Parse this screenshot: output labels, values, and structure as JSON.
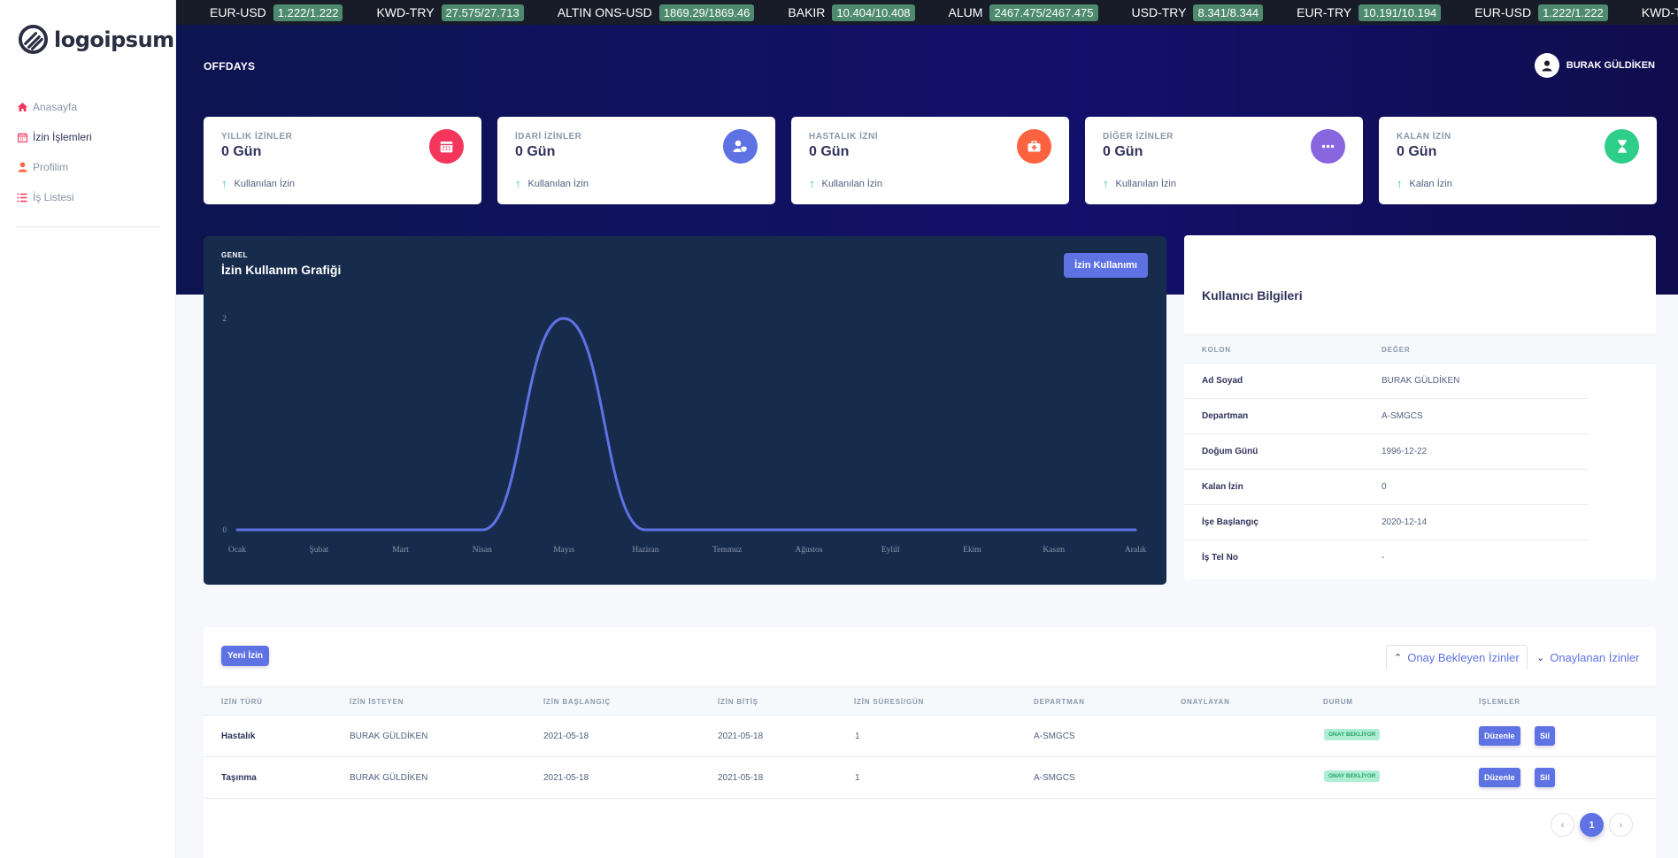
{
  "brand": {
    "name": "logoipsum"
  },
  "sidebar": {
    "items": [
      {
        "label": "Anasayfa",
        "icon": "home-icon",
        "color": "#f5365c"
      },
      {
        "label": "İzin İşlemleri",
        "icon": "calendar-icon",
        "color": "#f5365c"
      },
      {
        "label": "Profilim",
        "icon": "user-icon",
        "color": "#fb6340"
      },
      {
        "label": "İş Listesi",
        "icon": "list-icon",
        "color": "#f5365c"
      }
    ]
  },
  "ticker": [
    {
      "name": "EUR-USD",
      "value": "1.222/1.222"
    },
    {
      "name": "KWD-TRY",
      "value": "27.575/27.713"
    },
    {
      "name": "ALTIN ONS-USD",
      "value": "1869.29/1869.46"
    },
    {
      "name": "BAKIR",
      "value": "10.404/10.408"
    },
    {
      "name": "ALUM",
      "value": "2467.475/2467.475"
    },
    {
      "name": "USD-TRY",
      "value": "8.341/8.344"
    },
    {
      "name": "EUR-TRY",
      "value": "10.191/10.194"
    },
    {
      "name": "EUR-USD",
      "value": "1.222/1.222"
    },
    {
      "name": "KWD-TRY",
      "value": ""
    }
  ],
  "header": {
    "title": "OFFDAYS",
    "user_name": "BURAK GÜLDİKEN"
  },
  "stats": [
    {
      "label": "YILLIK İZİNLER",
      "value": "0 Gün",
      "foot": "Kullanılan İzin",
      "icon": "calendar-icon",
      "color": "#f5365c"
    },
    {
      "label": "İDARİ İZİNLER",
      "value": "0 Gün",
      "foot": "Kullanılan İzin",
      "icon": "user-shield-icon",
      "color": "#5e72e4"
    },
    {
      "label": "HASTALIK İZNİ",
      "value": "0 Gün",
      "foot": "Kullanılan İzin",
      "icon": "medkit-icon",
      "color": "#fb6340"
    },
    {
      "label": "DİĞER İZİNLER",
      "value": "0 Gün",
      "foot": "Kullanılan İzin",
      "icon": "more-icon",
      "color": "#8965e0"
    },
    {
      "label": "KALAN İZİN",
      "value": "0 Gün",
      "foot": "Kalan İzin",
      "icon": "hourglass-icon",
      "color": "#2dce89"
    }
  ],
  "chart": {
    "kicker": "GENEL",
    "title": "İzin Kullanım Grafiği",
    "button": "İzin Kullanımı"
  },
  "chart_data": {
    "type": "line",
    "title": "İzin Kullanım Grafiği",
    "categories": [
      "Ocak",
      "Şubat",
      "Mart",
      "Nisan",
      "Mayıs",
      "Haziran",
      "Temmuz",
      "Ağustos",
      "Eylül",
      "Ekim",
      "Kasım",
      "Aralık"
    ],
    "values": [
      0,
      0,
      0,
      0,
      2,
      0,
      0,
      0,
      0,
      0,
      0,
      0
    ],
    "yticks": [
      "2",
      "0"
    ],
    "ylim": [
      0,
      2
    ],
    "line_color": "#5e72e4",
    "grid": false,
    "legend": "none"
  },
  "user_info": {
    "title": "Kullanıcı Bilgileri",
    "columns": [
      "KOLON",
      "DEĞER"
    ],
    "rows": [
      {
        "key": "Ad Soyad",
        "value": "BURAK GÜLDİKEN"
      },
      {
        "key": "Departman",
        "value": "A-SMGCS"
      },
      {
        "key": "Doğum Günü",
        "value": "1996-12-22"
      },
      {
        "key": "Kalan İzin",
        "value": "0"
      },
      {
        "key": "İşe Başlangıç",
        "value": "2020-12-14"
      },
      {
        "key": "İş Tel No",
        "value": "-"
      }
    ]
  },
  "requests": {
    "new_button": "Yeni İzin",
    "tabs": [
      "Onay Bekleyen İzinler",
      "Onaylanan İzinler"
    ],
    "columns": [
      "İZİN TÜRÜ",
      "İZİN İSTEYEN",
      "İZİN BAŞLANGIÇ",
      "İZİN BİTİŞ",
      "İZİN SÜRESİ/GÜN",
      "DEPARTMAN",
      "ONAYLAYAN",
      "DURUM",
      "İŞLEMLER"
    ],
    "rows": [
      {
        "type": "Hastalık",
        "requester": "BURAK GÜLDİKEN",
        "start": "2021-05-18",
        "end": "2021-05-18",
        "days": "1",
        "department": "A-SMGCS",
        "approver": "",
        "status": "ONAY BEKLİYOR",
        "edit": "Düzenle",
        "delete": "Sil"
      },
      {
        "type": "Taşınma",
        "requester": "BURAK GÜLDİKEN",
        "start": "2021-05-18",
        "end": "2021-05-18",
        "days": "1",
        "department": "A-SMGCS",
        "approver": "",
        "status": "ONAY BEKLİYOR",
        "edit": "Düzenle",
        "delete": "Sil"
      }
    ],
    "pagination": {
      "prev": "‹",
      "current": "1",
      "next": "›"
    }
  }
}
